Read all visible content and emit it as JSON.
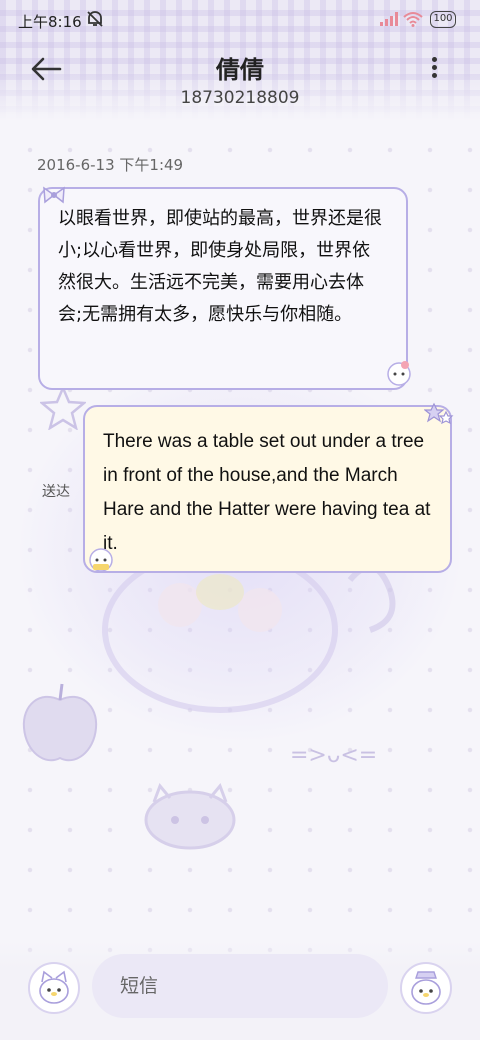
{
  "status_bar": {
    "time": "上午8:16",
    "battery": "100",
    "icons": [
      "mute-icon",
      "signal-icon",
      "wifi-icon",
      "battery-icon"
    ]
  },
  "header": {
    "contact_name": "倩倩",
    "contact_number": "18730218809",
    "icons": [
      "back-arrow-icon",
      "more-vertical-icon"
    ]
  },
  "conversation": {
    "timestamp": "2016-6-13 下午1:49",
    "messages": [
      {
        "direction": "received",
        "text": "以眼看世界，即使站的最高，世界还是很小;以心看世界，即使身处局限，世界依然很大。生活远不完美，需要用心去体会;无需拥有太多，愿快乐与你相随。"
      },
      {
        "direction": "sent",
        "status": "送达",
        "text": "There was a table set out under a tree in front of the house,and the March Hare and the Hatter were having tea at it."
      }
    ]
  },
  "composer": {
    "placeholder": "短信",
    "icons": [
      "sticker-cat-icon",
      "send-cat-icon"
    ]
  },
  "colors": {
    "bubble_border": "#b7aee6",
    "sent_bubble_bg": "#fff9e6",
    "received_bubble_bg": "#f8f7fc",
    "input_bg": "#ebe8f6"
  }
}
